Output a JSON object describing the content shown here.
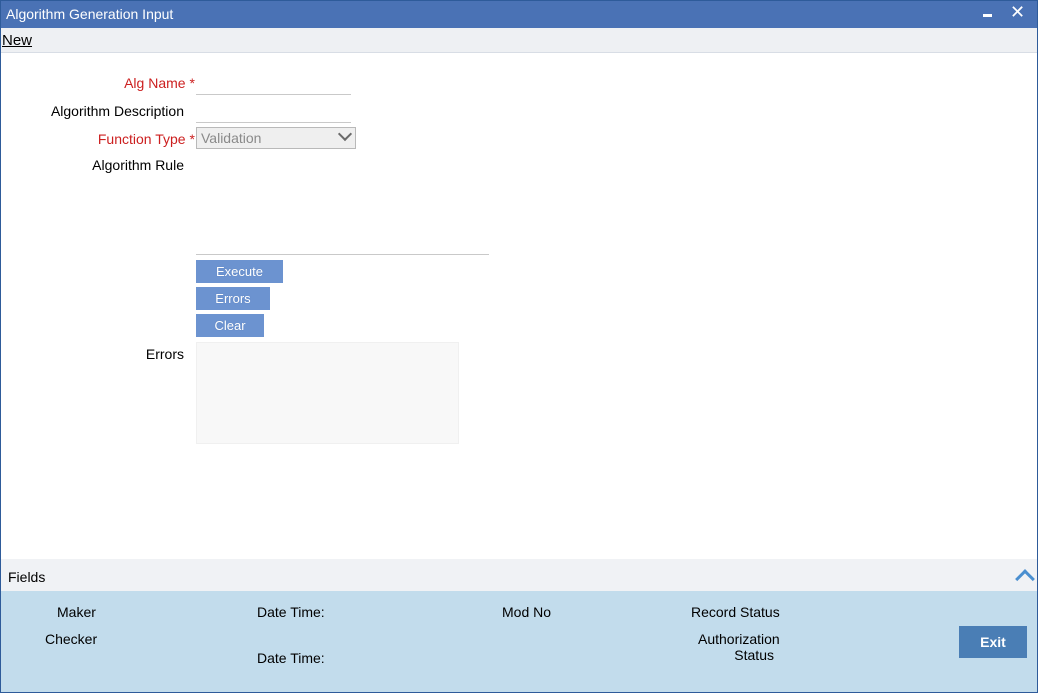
{
  "window": {
    "title": "Algorithm Generation Input",
    "minimize_icon": "minimize-icon",
    "close_icon": "close-icon",
    "close_glyph": "✕"
  },
  "menu": {
    "new_label": "New"
  },
  "form": {
    "alg_name_label": "Alg Name",
    "required_marker": "*",
    "alg_name_value": "",
    "description_label": "Algorithm Description",
    "description_value": "",
    "function_type_label": "Function Type",
    "function_type_value": "Validation",
    "rule_label": "Algorithm Rule",
    "rule_value": "",
    "execute_label": "Execute",
    "errors_button_label": "Errors",
    "clear_label": "Clear",
    "errors_label": "Errors",
    "errors_value": ""
  },
  "fields_bar": {
    "label": "Fields",
    "expand_icon": "chevron-up-icon"
  },
  "footer": {
    "maker_label": "Maker",
    "checker_label": "Checker",
    "date_time_label_1": "Date Time:",
    "date_time_label_2": "Date Time:",
    "mod_no_label": "Mod No",
    "record_status_label": "Record Status",
    "authorization_label_line1": "Authorization",
    "authorization_label_line2": "Status",
    "exit_label": "Exit"
  },
  "colors": {
    "titlebar": "#4a72b5",
    "button": "#6c93d0",
    "footer": "#c2dcec",
    "required": "#cc1f1f"
  }
}
